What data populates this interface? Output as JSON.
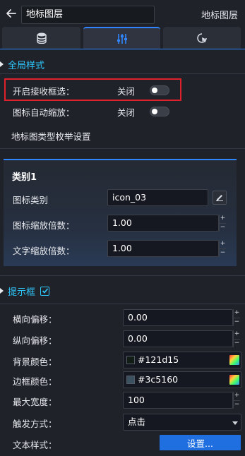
{
  "header": {
    "title_value": "地标图层",
    "right_label": "地标图层"
  },
  "tabs": [
    {
      "icon": "database-icon",
      "active": false
    },
    {
      "icon": "sliders-icon",
      "active": true
    },
    {
      "icon": "interaction-cursor-icon",
      "active": false
    }
  ],
  "global_style": {
    "section_label": "全局样式",
    "enable_box_select_label": "开启接收框选：",
    "enable_box_select_value": "关闭",
    "icon_auto_scale_label": "图标自动缩放：",
    "icon_auto_scale_value": "关闭",
    "enum_settings_label": "地标图类型枚举设置"
  },
  "category_card": {
    "title": "类别1",
    "icon_type_label": "图标类别",
    "icon_type_value": "icon_03",
    "icon_scale_label": "图标缩放倍数：",
    "icon_scale_value": "1.00",
    "text_scale_label": "文字缩放倍数：",
    "text_scale_value": "1.00"
  },
  "tooltip": {
    "section_label": "提示框",
    "enabled": true,
    "offset_x_label": "横向偏移：",
    "offset_x_value": "0.00",
    "offset_y_label": "纵向偏移：",
    "offset_y_value": "0.00",
    "bg_color_label": "背景颜色：",
    "bg_color_value": "#121d15",
    "border_color_label": "边框颜色：",
    "border_color_value": "#3c5160",
    "max_width_label": "最大宽度：",
    "max_width_value": "100",
    "trigger_label": "触发方式：",
    "trigger_value": "点击",
    "text_style_label": "文本样式：",
    "text_style_button": "设置..."
  },
  "colors": {
    "accent": "#2f86ff",
    "section_label": "#2ec9ff",
    "highlight_border": "#e0202a",
    "primary_button": "#1f6fe0"
  }
}
